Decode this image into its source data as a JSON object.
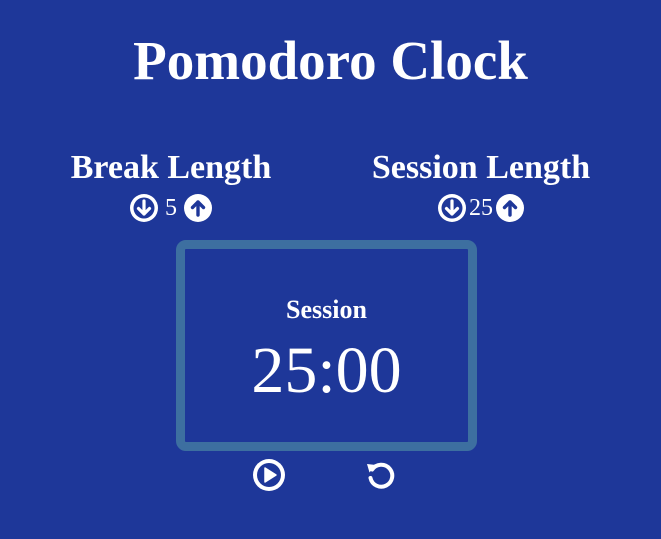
{
  "app": {
    "title": "Pomodoro Clock"
  },
  "break_control": {
    "label": "Break Length",
    "value": "5",
    "decrement_icon": "arrow-down-circle-icon",
    "increment_icon": "arrow-up-circle-icon"
  },
  "session_control": {
    "label": "Session Length",
    "value": "25",
    "decrement_icon": "arrow-down-circle-icon",
    "increment_icon": "arrow-up-circle-icon"
  },
  "timer": {
    "label": "Session",
    "time_left": "25:00"
  },
  "controls": {
    "start_stop_icon": "play-circle-icon",
    "reset_icon": "reset-icon"
  },
  "colors": {
    "background": "#1e3799",
    "timer_border": "#3d6fa0",
    "text": "#ffffff"
  }
}
